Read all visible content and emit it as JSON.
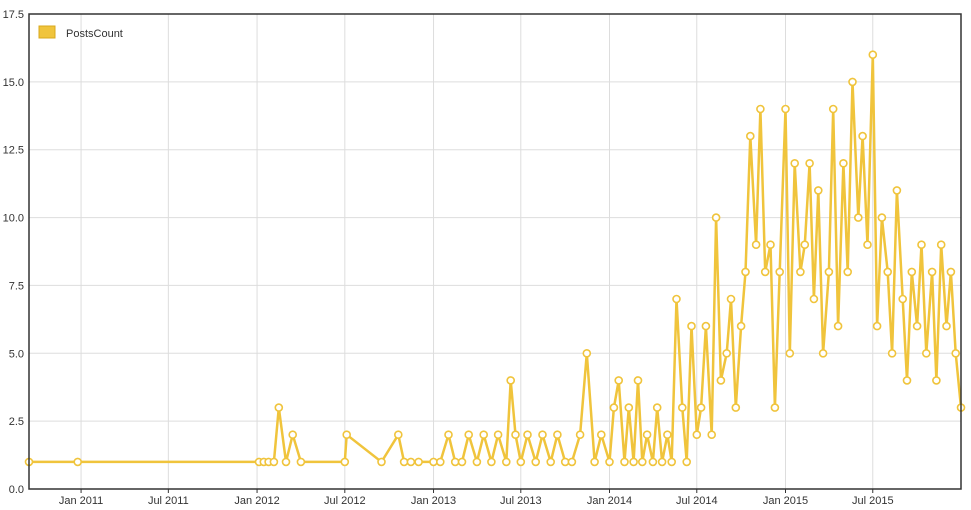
{
  "chart_data": {
    "type": "line",
    "title": "",
    "xlabel": "",
    "ylabel": "",
    "legend": {
      "position": "top-left",
      "entries": [
        "PostsCount"
      ]
    },
    "grid": true,
    "x_range": [
      "2010-09-15",
      "2015-12-31"
    ],
    "ylim": [
      0,
      17.5
    ],
    "y_ticks": [
      "0.0",
      "2.5",
      "5.0",
      "7.5",
      "10.0",
      "12.5",
      "15.0",
      "17.5"
    ],
    "x_ticks": [
      {
        "date": "2011-01-01",
        "label": "Jan 2011"
      },
      {
        "date": "2011-07-01",
        "label": "Jul 2011"
      },
      {
        "date": "2012-01-01",
        "label": "Jan 2012"
      },
      {
        "date": "2012-07-01",
        "label": "Jul 2012"
      },
      {
        "date": "2013-01-01",
        "label": "Jan 2013"
      },
      {
        "date": "2013-07-01",
        "label": "Jul 2013"
      },
      {
        "date": "2014-01-01",
        "label": "Jan 2014"
      },
      {
        "date": "2014-07-01",
        "label": "Jul 2014"
      },
      {
        "date": "2015-01-01",
        "label": "Jan 2015"
      },
      {
        "date": "2015-07-01",
        "label": "Jul 2015"
      }
    ],
    "colors": {
      "series": "#f0c43c",
      "marker_fill": "#ffffff",
      "grid": "#dddddd",
      "axis": "#333333"
    },
    "series": [
      {
        "name": "PostsCount",
        "x": [
          "2010-09-15",
          "2010-12-25",
          "2012-01-05",
          "2012-01-15",
          "2012-01-25",
          "2012-02-05",
          "2012-02-15",
          "2012-03-01",
          "2012-03-15",
          "2012-04-01",
          "2012-07-01",
          "2012-07-05",
          "2012-09-15",
          "2012-10-20",
          "2012-11-01",
          "2012-11-15",
          "2012-12-01",
          "2013-01-01",
          "2013-01-15",
          "2013-02-01",
          "2013-02-15",
          "2013-03-01",
          "2013-03-15",
          "2013-04-01",
          "2013-04-15",
          "2013-05-01",
          "2013-05-15",
          "2013-06-01",
          "2013-06-10",
          "2013-06-20",
          "2013-07-01",
          "2013-07-15",
          "2013-08-01",
          "2013-08-15",
          "2013-09-01",
          "2013-09-15",
          "2013-10-01",
          "2013-10-15",
          "2013-11-01",
          "2013-11-15",
          "2013-12-01",
          "2013-12-15",
          "2014-01-01",
          "2014-01-10",
          "2014-01-20",
          "2014-02-01",
          "2014-02-10",
          "2014-02-20",
          "2014-03-01",
          "2014-03-10",
          "2014-03-20",
          "2014-04-01",
          "2014-04-10",
          "2014-04-20",
          "2014-05-01",
          "2014-05-10",
          "2014-05-20",
          "2014-06-01",
          "2014-06-10",
          "2014-06-20",
          "2014-07-01",
          "2014-07-10",
          "2014-07-20",
          "2014-08-01",
          "2014-08-10",
          "2014-08-20",
          "2014-09-01",
          "2014-09-10",
          "2014-09-20",
          "2014-10-01",
          "2014-10-10",
          "2014-10-20",
          "2014-11-01",
          "2014-11-10",
          "2014-11-20",
          "2014-12-01",
          "2014-12-10",
          "2014-12-20",
          "2015-01-01",
          "2015-01-10",
          "2015-01-20",
          "2015-02-01",
          "2015-02-10",
          "2015-02-20",
          "2015-03-01",
          "2015-03-10",
          "2015-03-20",
          "2015-04-01",
          "2015-04-10",
          "2015-04-20",
          "2015-05-01",
          "2015-05-10",
          "2015-05-20",
          "2015-06-01",
          "2015-06-10",
          "2015-06-20",
          "2015-07-01",
          "2015-07-10",
          "2015-07-20",
          "2015-08-01",
          "2015-08-10",
          "2015-08-20",
          "2015-09-01",
          "2015-09-10",
          "2015-09-20",
          "2015-10-01",
          "2015-10-10",
          "2015-10-20",
          "2015-11-01",
          "2015-11-10",
          "2015-11-20",
          "2015-12-01",
          "2015-12-10",
          "2015-12-20",
          "2015-12-31"
        ],
        "values": [
          1,
          1,
          1,
          1,
          1,
          1,
          3,
          1,
          2,
          1,
          1,
          2,
          1,
          2,
          1,
          1,
          1,
          1,
          1,
          2,
          1,
          1,
          2,
          1,
          2,
          1,
          2,
          1,
          4,
          2,
          1,
          2,
          1,
          2,
          1,
          2,
          1,
          1,
          2,
          5,
          1,
          2,
          1,
          3,
          4,
          1,
          3,
          1,
          4,
          1,
          2,
          1,
          3,
          1,
          2,
          1,
          7,
          3,
          1,
          6,
          2,
          3,
          6,
          2,
          10,
          4,
          5,
          7,
          3,
          6,
          8,
          13,
          9,
          14,
          8,
          9,
          3,
          8,
          14,
          5,
          12,
          8,
          9,
          12,
          7,
          11,
          5,
          8,
          14,
          6,
          12,
          8,
          15,
          10,
          13,
          9,
          16,
          6,
          10,
          8,
          5,
          11,
          7,
          4,
          8,
          6,
          9,
          5,
          8,
          4,
          9,
          6,
          8,
          5,
          3
        ]
      }
    ]
  }
}
